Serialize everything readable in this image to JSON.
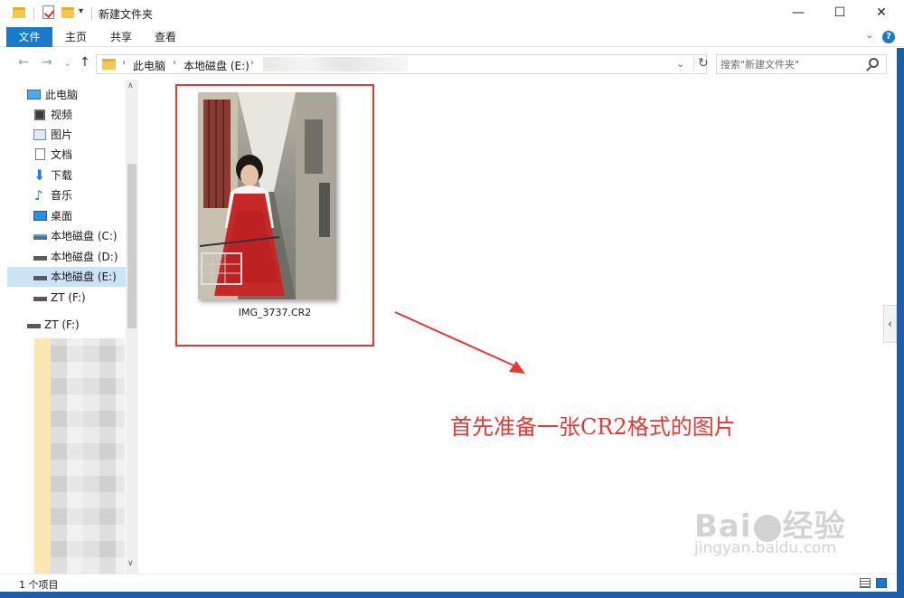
{
  "window": {
    "title": "新建文件夹",
    "minimize": "—",
    "maximize": "☐",
    "close": "✕",
    "qa_dropdown": "▾"
  },
  "ribbon": {
    "tabs": [
      "文件",
      "主页",
      "共享",
      "查看"
    ],
    "expand": "⌄",
    "help": "?"
  },
  "nav": {
    "back": "←",
    "forward": "→",
    "recent": "⌄",
    "up": "↑",
    "breadcrumb": [
      "此电脑",
      "本地磁盘 (E:)"
    ],
    "crumb_sep": "›",
    "dropdown": "⌄",
    "refresh": "↻"
  },
  "search": {
    "placeholder": "搜索\"新建文件夹\""
  },
  "sidebar": {
    "items": [
      {
        "label": "此电脑",
        "icon": "pc-icon"
      },
      {
        "label": "视频",
        "icon": "video-icon"
      },
      {
        "label": "图片",
        "icon": "picture-icon"
      },
      {
        "label": "文档",
        "icon": "document-icon"
      },
      {
        "label": "下载",
        "icon": "download-icon"
      },
      {
        "label": "音乐",
        "icon": "music-icon"
      },
      {
        "label": "桌面",
        "icon": "desktop-icon"
      },
      {
        "label": "本地磁盘 (C:)",
        "icon": "drive-icon"
      },
      {
        "label": "本地磁盘 (D:)",
        "icon": "drive-icon"
      },
      {
        "label": "本地磁盘 (E:)",
        "icon": "drive-icon"
      },
      {
        "label": "ZT (F:)",
        "icon": "drive-icon"
      },
      {
        "label": "ZT (F:)",
        "icon": "drive-icon"
      }
    ],
    "scroll_up": "∧",
    "scroll_down": "∨"
  },
  "files": [
    {
      "name": "IMG_3737.CR2"
    }
  ],
  "annotation": "首先准备一张CR2格式的图片",
  "watermark": {
    "logo_left": "Bai",
    "logo_right": "经验",
    "url": "jingyan.baidu.com"
  },
  "pane_toggle": "‹",
  "status": {
    "item_count": "1 个项目"
  },
  "colors": {
    "accent": "#1979ca",
    "annotation_red": "#e53935",
    "selected": "#cce4f7"
  }
}
